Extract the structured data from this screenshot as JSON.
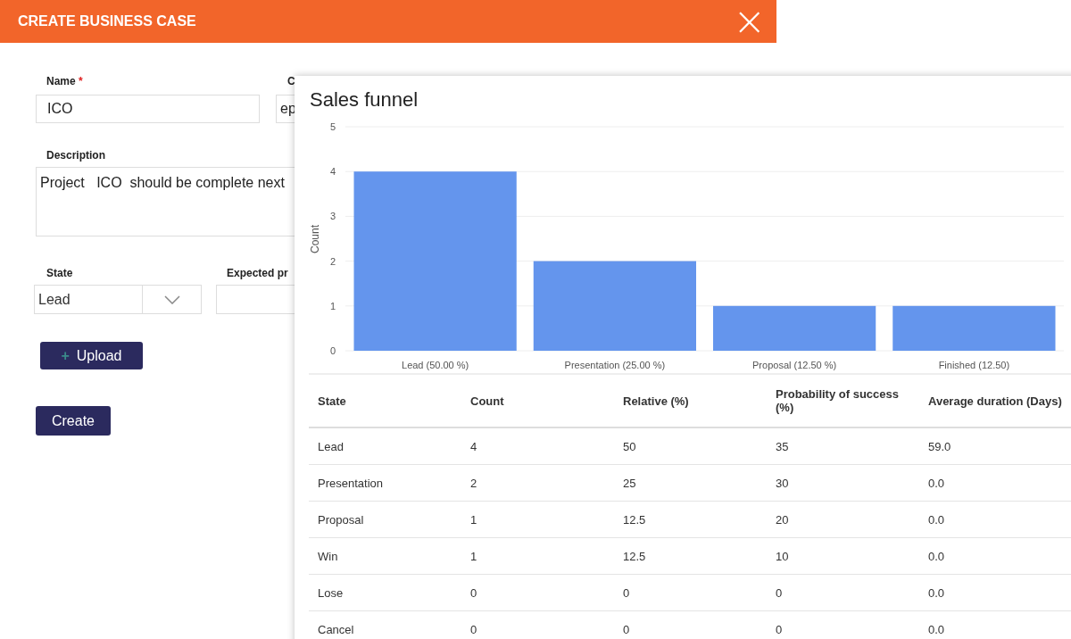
{
  "header": {
    "title": "CREATE BUSINESS CASE",
    "close": "×"
  },
  "form": {
    "name": {
      "label": "Name",
      "required": "*",
      "value": "ICO"
    },
    "column_2": {
      "label": "C",
      "value": "ep"
    },
    "description": {
      "label": "Description",
      "value": "Project   ICO  should be complete next"
    },
    "state": {
      "label": "State",
      "value": "Lead"
    },
    "expected": {
      "label": "Expected pr"
    },
    "upload": {
      "icon": "+",
      "label": "Upload"
    },
    "create": "Create"
  },
  "panel": {
    "chart_data": {
      "type": "bar",
      "title": "Sales funnel",
      "ylabel": "Count",
      "categories": [
        "Lead (50.00 %)",
        "Presentation (25.00 %)",
        "Proposal (12.50 %)",
        "Finished (12.50)"
      ],
      "values": [
        4,
        2,
        1,
        1
      ],
      "ylim": [
        0,
        5
      ],
      "yticks": [
        0,
        1,
        2,
        3,
        4,
        5
      ],
      "grid": true
    },
    "table": {
      "columns": [
        "State",
        "Count",
        "Relative (%)",
        "Probability of success (%)",
        "Average duration (Days)"
      ],
      "rows": [
        [
          "Lead",
          "4",
          "50",
          "35",
          "59.0"
        ],
        [
          "Presentation",
          "2",
          "25",
          "30",
          "0.0"
        ],
        [
          "Proposal",
          "1",
          "12.5",
          "20",
          "0.0"
        ],
        [
          "Win",
          "1",
          "12.5",
          "10",
          "0.0"
        ],
        [
          "Lose",
          "0",
          "0",
          "0",
          "0.0"
        ],
        [
          "Cancel",
          "0",
          "0",
          "0",
          "0.0"
        ]
      ]
    }
  }
}
